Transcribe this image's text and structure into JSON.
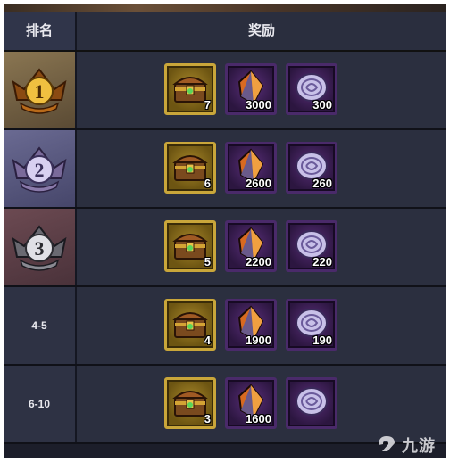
{
  "header": {
    "rank_label": "排名",
    "reward_label": "奖励"
  },
  "colors": {
    "gold_border": "#c9a63a",
    "purple_bg": "#2c1640",
    "row_bg": "#2b2f3f"
  },
  "rows": [
    {
      "rank": "1",
      "rank_style": "gold-badge-icon",
      "items": [
        {
          "icon": "treasure-chest-icon",
          "qty": "7"
        },
        {
          "icon": "crystal-shard-icon",
          "qty": "3000"
        },
        {
          "icon": "silver-coin-icon",
          "qty": "300"
        }
      ]
    },
    {
      "rank": "2",
      "rank_style": "silver-badge-icon",
      "items": [
        {
          "icon": "treasure-chest-icon",
          "qty": "6"
        },
        {
          "icon": "crystal-shard-icon",
          "qty": "2600"
        },
        {
          "icon": "silver-coin-icon",
          "qty": "260"
        }
      ]
    },
    {
      "rank": "3",
      "rank_style": "bronze-badge-icon",
      "items": [
        {
          "icon": "treasure-chest-icon",
          "qty": "5"
        },
        {
          "icon": "crystal-shard-icon",
          "qty": "2200"
        },
        {
          "icon": "silver-coin-icon",
          "qty": "220"
        }
      ]
    },
    {
      "rank": "4-5",
      "items": [
        {
          "icon": "treasure-chest-icon",
          "qty": "4"
        },
        {
          "icon": "crystal-shard-icon",
          "qty": "1900"
        },
        {
          "icon": "silver-coin-icon",
          "qty": "190"
        }
      ]
    },
    {
      "rank": "6-10",
      "items": [
        {
          "icon": "treasure-chest-icon",
          "qty": "3"
        },
        {
          "icon": "crystal-shard-icon",
          "qty": "1600"
        },
        {
          "icon": "silver-coin-icon",
          "qty": ""
        }
      ]
    }
  ],
  "watermark": {
    "text": "九游"
  }
}
